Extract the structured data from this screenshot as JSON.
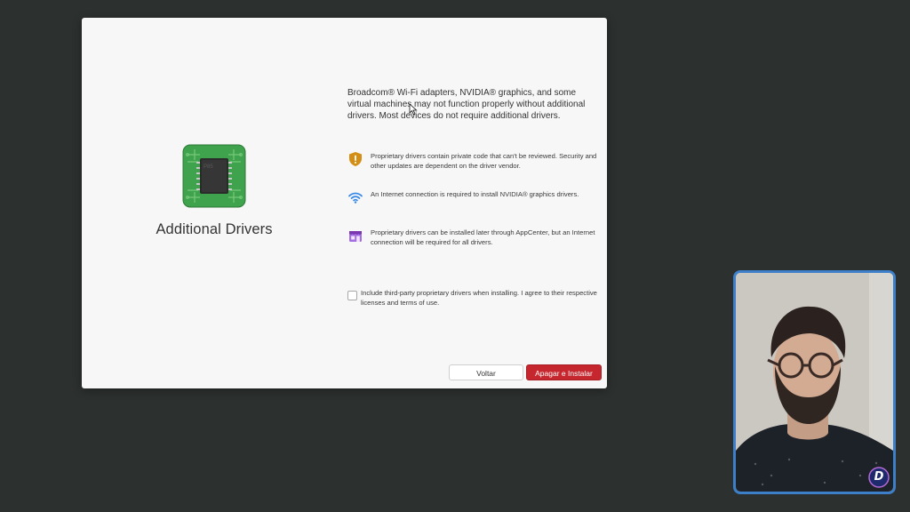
{
  "left": {
    "icon": "chip-icon",
    "title": "Additional Drivers"
  },
  "content": {
    "intro": "Broadcom® Wi-Fi adapters, NVIDIA® graphics, and some virtual machines may not function properly without additional drivers. Most devices do not require additional drivers.",
    "notes": [
      {
        "icon": "shield-warning-icon",
        "text": "Proprietary drivers contain private code that can't be reviewed. Security and other updates are dependent on the driver vendor."
      },
      {
        "icon": "wifi-icon",
        "text": "An Internet connection is required to install NVIDIA® graphics drivers."
      },
      {
        "icon": "appcenter-icon",
        "text": "Proprietary drivers can be installed later through AppCenter, but an Internet connection will be required for all drivers."
      }
    ],
    "checkbox": {
      "label": "Include third-party proprietary drivers when installing. I agree to their respective licenses and terms of use.",
      "checked": false
    }
  },
  "buttons": {
    "back": "Voltar",
    "install": "Apagar e Instalar"
  },
  "colors": {
    "accent_destructive": "#c6262e",
    "chip_green": "#3fa34d",
    "shield_orange": "#d48e15",
    "wifi_blue": "#3689e6",
    "appcenter_purple": "#a56de2",
    "webcam_border": "#3d7fc9"
  },
  "overlay": {
    "webcam": "webcam-video",
    "channel_logo_letter": "D"
  }
}
